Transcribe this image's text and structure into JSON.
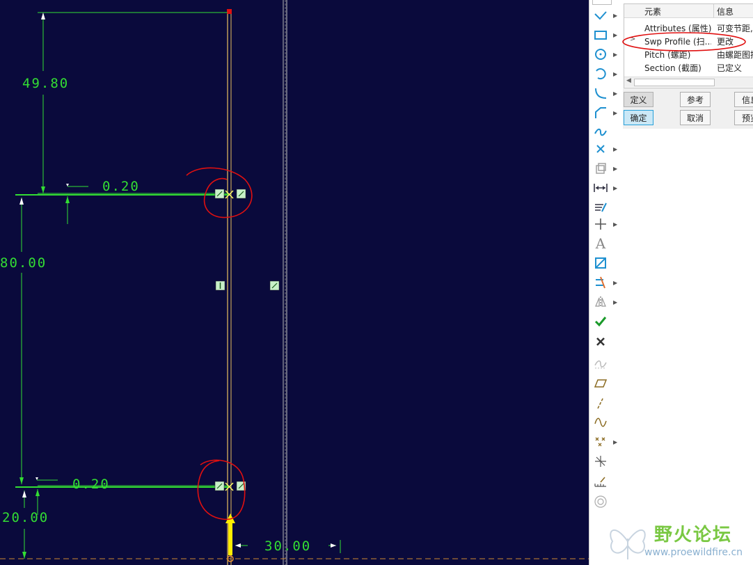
{
  "sketch": {
    "dimensions": [
      "49.80",
      "0.20",
      "80.00",
      "0.20",
      "20.00",
      "30.00"
    ]
  },
  "toolbar": {
    "icons": [
      "line-icon",
      "rectangle-icon",
      "circle-icon",
      "arc-icon",
      "fillet-icon",
      "chamfer-icon",
      "spline-icon",
      "point-icon",
      "offset-icon",
      "dimension-icon",
      "modify-icon",
      "constraint-icon",
      "text-icon",
      "palette-icon",
      "trim-icon",
      "mirror-icon",
      "accept-icon",
      "cancel-icon",
      "curve-icon",
      "parallelogram-icon",
      "construction-line-icon",
      "wave-icon",
      "construction-point-icon",
      "coordinate-system-icon",
      "ruler-icon",
      "region-icon"
    ]
  },
  "panel": {
    "headers": {
      "element": "元素",
      "info": "信息"
    },
    "rows": [
      {
        "element": "Attributes (属性)",
        "info": "可变节距,"
      },
      {
        "element": "Swp Profile (扫...",
        "info": "更改",
        "marker": ">"
      },
      {
        "element": "Pitch (螺距)",
        "info": "由螺距图控"
      },
      {
        "element": "Section (截面)",
        "info": "已定义"
      }
    ],
    "buttons": {
      "define": "定义",
      "reference": "参考",
      "info": "信息",
      "ok": "确定",
      "cancel": "取消",
      "preview": "预览"
    }
  },
  "watermark": {
    "title": "野火论坛",
    "url": "www.proewildfire.cn"
  },
  "colors": {
    "canvas": "#0a0a3c",
    "dimension": "#33dd33",
    "centerline": "#e8c060",
    "annotation": "#e01010"
  }
}
